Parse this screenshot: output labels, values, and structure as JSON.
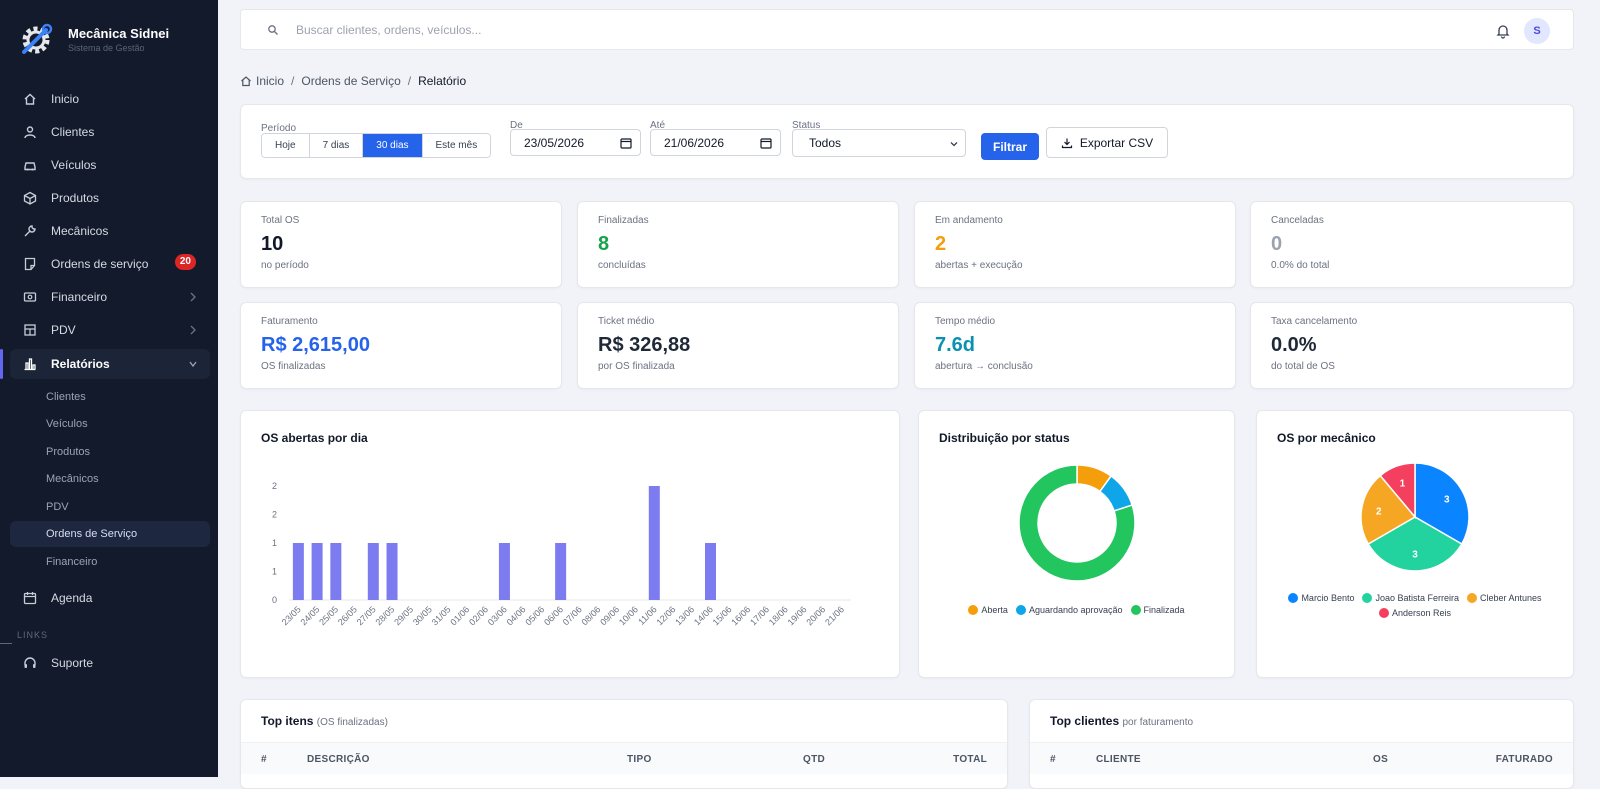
{
  "brand": {
    "title": "Mecânica Sidnei",
    "subtitle": "Sistema de Gestão"
  },
  "nav": [
    {
      "label": "Inicio",
      "icon": "home-icon"
    },
    {
      "label": "Clientes",
      "icon": "user-icon"
    },
    {
      "label": "Veículos",
      "icon": "car-icon"
    },
    {
      "label": "Produtos",
      "icon": "box-icon"
    },
    {
      "label": "Mecânicos",
      "icon": "wrench-icon"
    },
    {
      "label": "Ordens de serviço",
      "icon": "document-icon",
      "badge": "20"
    },
    {
      "label": "Financeiro",
      "icon": "cash-icon"
    },
    {
      "label": "PDV",
      "icon": "store-icon"
    },
    {
      "label": "Relatórios",
      "icon": "bar-chart-icon"
    }
  ],
  "subnav": [
    "Clientes",
    "Veículos",
    "Produtos",
    "Mecânicos",
    "PDV",
    "Ordens de Serviço",
    "Financeiro"
  ],
  "agenda": "Agenda",
  "links_label": "LINKS",
  "suporte": "Suporte",
  "search": {
    "placeholder": "Buscar clientes, ordens, veículos..."
  },
  "user_initial": "S",
  "breadcrumb": {
    "home": "Inicio",
    "section": "Ordens de Serviço",
    "current": "Relatório"
  },
  "filters": {
    "periodo_label": "Período",
    "periods": [
      "Hoje",
      "7 dias",
      "30 dias",
      "Este mês"
    ],
    "active_period": "30 dias",
    "de_label": "De",
    "de_value": "23/05/2026",
    "ate_label": "Até",
    "ate_value": "21/06/2026",
    "status_label": "Status",
    "status_value": "Todos",
    "filter_button": "Filtrar",
    "export_button": "Exportar CSV"
  },
  "kpis": [
    {
      "label": "Total OS",
      "value": "10",
      "sub": "no período",
      "color": "#111827"
    },
    {
      "label": "Finalizadas",
      "value": "8",
      "sub": "concluídas",
      "color": "#16a34a"
    },
    {
      "label": "Em andamento",
      "value": "2",
      "sub": "abertas + execução",
      "color": "#f59e0b"
    },
    {
      "label": "Canceladas",
      "value": "0",
      "sub": "0.0% do total",
      "color": "#9ca3af"
    },
    {
      "label": "Faturamento",
      "value": "R$ 2,615,00",
      "sub": "OS finalizadas",
      "color": "#2563eb"
    },
    {
      "label": "Ticket médio",
      "value": "R$ 326,88",
      "sub": "por OS finalizada",
      "color": "#1f2937"
    },
    {
      "label": "Tempo médio",
      "value": "7.6d",
      "sub": "abertura → conclusão",
      "color": "#0891b2"
    },
    {
      "label": "Taxa cancelamento",
      "value": "0.0%",
      "sub": "do total de OS",
      "color": "#1f2937"
    }
  ],
  "charts": {
    "bar_title": "OS abertas por dia",
    "donut_title": "Distribuição por status",
    "pie_title": "OS por mecânico"
  },
  "chart_data": [
    {
      "type": "bar",
      "title": "OS abertas por dia",
      "categories": [
        "23/05",
        "24/05",
        "25/05",
        "26/05",
        "27/05",
        "28/05",
        "29/05",
        "30/05",
        "31/05",
        "01/06",
        "02/06",
        "03/06",
        "04/06",
        "05/06",
        "06/06",
        "07/06",
        "08/06",
        "09/06",
        "10/06",
        "11/06",
        "12/06",
        "13/06",
        "14/06",
        "15/06",
        "16/06",
        "17/06",
        "18/06",
        "19/06",
        "20/06",
        "21/06"
      ],
      "values": [
        1,
        1,
        1,
        0,
        1,
        1,
        0,
        0,
        0,
        0,
        0,
        1,
        0,
        0,
        1,
        0,
        0,
        0,
        0,
        2,
        0,
        0,
        1,
        0,
        0,
        0,
        0,
        0,
        0,
        0
      ],
      "yticks": [
        "0",
        "1",
        "1",
        "2",
        "2"
      ],
      "ylim": [
        0,
        2
      ],
      "color": "#7c7cf0"
    },
    {
      "type": "pie",
      "title": "Distribuição por status",
      "donut": true,
      "series": [
        {
          "name": "Aberta",
          "value": 1,
          "color": "#f59e0b"
        },
        {
          "name": "Aguardando aprovação",
          "value": 1,
          "color": "#0ea5e9"
        },
        {
          "name": "Finalizada",
          "value": 8,
          "color": "#22c55e"
        }
      ]
    },
    {
      "type": "pie",
      "title": "OS por mecânico",
      "series": [
        {
          "name": "Marcio Bento",
          "value": 3,
          "color": "#0a84ff"
        },
        {
          "name": "Joao Batista Ferreira",
          "value": 3,
          "color": "#22d3a0"
        },
        {
          "name": "Cleber Antunes",
          "value": 2,
          "color": "#f5a623"
        },
        {
          "name": "Anderson Reis",
          "value": 1,
          "color": "#f43f5e"
        }
      ]
    }
  ],
  "top_itens": {
    "title": "Top itens",
    "subtitle": "(OS finalizadas)",
    "headers": [
      "#",
      "DESCRIÇÃO",
      "TIPO",
      "QTD",
      "TOTAL"
    ]
  },
  "top_clientes": {
    "title": "Top clientes",
    "subtitle": "por faturamento",
    "headers": [
      "#",
      "CLIENTE",
      "OS",
      "FATURADO"
    ]
  }
}
